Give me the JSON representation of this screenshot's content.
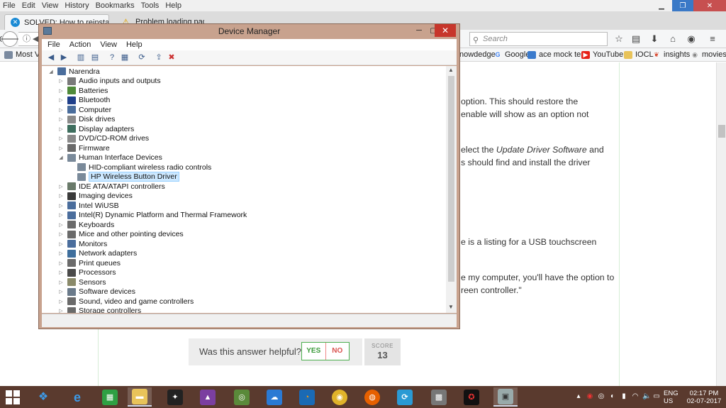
{
  "browser": {
    "menu": [
      "File",
      "Edit",
      "View",
      "History",
      "Bookmarks",
      "Tools",
      "Help"
    ],
    "tabs": [
      {
        "label": "SOLVED: How to reinstall to"
      },
      {
        "label": "Problem loading page"
      }
    ],
    "new_tab": "+",
    "url_prefix": "ⓘ ◀",
    "search_placeholder": "Search",
    "bookmarks": [
      {
        "label": "Most Vi"
      },
      {
        "label": "nowdedge"
      },
      {
        "label": "Google"
      },
      {
        "label": "ace mock test"
      },
      {
        "label": "YouTube"
      },
      {
        "label": "IOCL"
      },
      {
        "label": "insights"
      },
      {
        "label": "movies"
      }
    ]
  },
  "article": {
    "line1": "option. This should restore the",
    "line2": "enable will show as an option not",
    "line3_pre": "elect the ",
    "line3_em": "Update Driver Software",
    "line3_post": " and",
    "line4": "s should find and install the driver",
    "line5": "e is a listing for a USB touchscreen",
    "line6": "e my computer, you'll have the option to",
    "line7": "reen controller.\"",
    "feedback_question": "Was this answer helpful?",
    "yes": "YES",
    "no": "NO",
    "score_label": "SCORE",
    "score_value": "13"
  },
  "device_manager": {
    "title": "Device Manager",
    "menu": [
      "File",
      "Action",
      "View",
      "Help"
    ],
    "tree": [
      {
        "label": "Narendra",
        "level": 0,
        "expander": "◢",
        "icon": "computer-icon",
        "color": "#4a6d9c"
      },
      {
        "label": "Audio inputs and outputs",
        "level": 1,
        "expander": "▷",
        "icon": "speaker-icon",
        "color": "#7a7a7a"
      },
      {
        "label": "Batteries",
        "level": 1,
        "expander": "▷",
        "icon": "battery-icon",
        "color": "#4f8a3a"
      },
      {
        "label": "Bluetooth",
        "level": 1,
        "expander": "▷",
        "icon": "bluetooth-icon",
        "color": "#1f3f8a"
      },
      {
        "label": "Computer",
        "level": 1,
        "expander": "▷",
        "icon": "monitor-icon",
        "color": "#4a6d9c"
      },
      {
        "label": "Disk drives",
        "level": 1,
        "expander": "▷",
        "icon": "disk-icon",
        "color": "#8a8a8a"
      },
      {
        "label": "Display adapters",
        "level": 1,
        "expander": "▷",
        "icon": "display-icon",
        "color": "#3e6e5e"
      },
      {
        "label": "DVD/CD-ROM drives",
        "level": 1,
        "expander": "▷",
        "icon": "dvd-icon",
        "color": "#8a8a8a"
      },
      {
        "label": "Firmware",
        "level": 1,
        "expander": "▷",
        "icon": "chip-icon",
        "color": "#6a6a6a"
      },
      {
        "label": "Human Interface Devices",
        "level": 1,
        "expander": "◢",
        "icon": "hid-icon",
        "color": "#7a8a9a"
      },
      {
        "label": "HID-compliant wireless radio controls",
        "level": 2,
        "expander": "",
        "icon": "hid-icon",
        "color": "#7a8a9a"
      },
      {
        "label": "HP Wireless Button Driver",
        "level": 2,
        "expander": "",
        "icon": "hid-icon",
        "color": "#7a8a9a",
        "selected": true
      },
      {
        "label": "IDE ATA/ATAPI controllers",
        "level": 1,
        "expander": "▷",
        "icon": "ide-icon",
        "color": "#6a7a6a"
      },
      {
        "label": "Imaging devices",
        "level": 1,
        "expander": "▷",
        "icon": "camera-icon",
        "color": "#3a3a3a"
      },
      {
        "label": "Intel WiUSB",
        "level": 1,
        "expander": "▷",
        "icon": "usb-icon",
        "color": "#4a6d9c"
      },
      {
        "label": "Intel(R) Dynamic Platform and Thermal Framework",
        "level": 1,
        "expander": "▷",
        "icon": "chip-icon",
        "color": "#4a6d9c"
      },
      {
        "label": "Keyboards",
        "level": 1,
        "expander": "▷",
        "icon": "keyboard-icon",
        "color": "#6a6a6a"
      },
      {
        "label": "Mice and other pointing devices",
        "level": 1,
        "expander": "▷",
        "icon": "mouse-icon",
        "color": "#6a6a6a"
      },
      {
        "label": "Monitors",
        "level": 1,
        "expander": "▷",
        "icon": "monitor-icon",
        "color": "#4a6d9c"
      },
      {
        "label": "Network adapters",
        "level": 1,
        "expander": "▷",
        "icon": "network-icon",
        "color": "#3e6e9c"
      },
      {
        "label": "Print queues",
        "level": 1,
        "expander": "▷",
        "icon": "printer-icon",
        "color": "#6a6a6a"
      },
      {
        "label": "Processors",
        "level": 1,
        "expander": "▷",
        "icon": "cpu-icon",
        "color": "#4a4a4a"
      },
      {
        "label": "Sensors",
        "level": 1,
        "expander": "▷",
        "icon": "sensor-icon",
        "color": "#8a8a6a"
      },
      {
        "label": "Software devices",
        "level": 1,
        "expander": "▷",
        "icon": "software-icon",
        "color": "#6a7a8a"
      },
      {
        "label": "Sound, video and game controllers",
        "level": 1,
        "expander": "▷",
        "icon": "speaker-icon",
        "color": "#6a6a6a"
      },
      {
        "label": "Storage controllers",
        "level": 1,
        "expander": "▷",
        "icon": "storage-icon",
        "color": "#6a6a6a"
      }
    ]
  },
  "taskbar": {
    "language": "ENG",
    "region": "US",
    "time": "02:17 PM",
    "date": "02-07-2017"
  }
}
